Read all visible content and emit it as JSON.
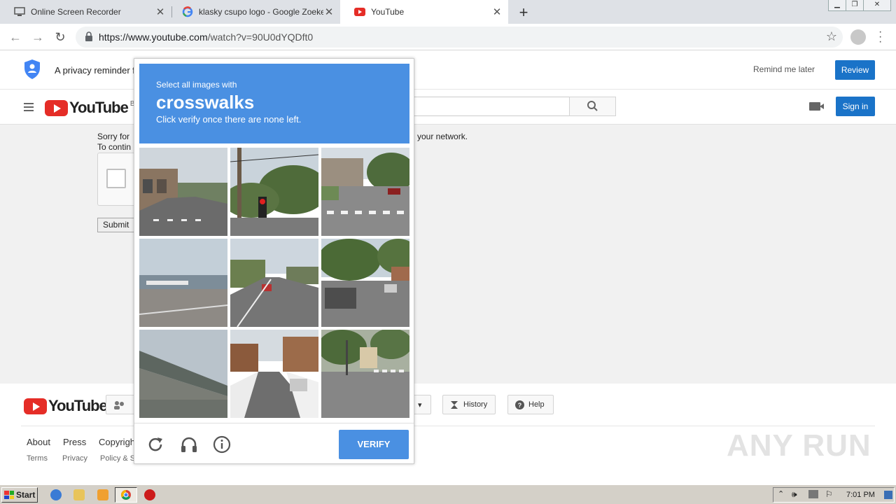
{
  "browser": {
    "tabs": [
      {
        "title": "Online Screen Recorder",
        "active": false
      },
      {
        "title": "klasky csupo logo - Google Zoeken",
        "active": false
      },
      {
        "title": "YouTube",
        "active": true
      }
    ],
    "url_host": "https://www.youtube.com",
    "url_path": "/watch?v=90U0dYQDft0"
  },
  "privacy": {
    "text": "A privacy reminder f",
    "remind_label": "Remind me later",
    "review_label": "Review"
  },
  "masthead": {
    "logo_text": "YouTube",
    "country_code": "BE",
    "signin_label": "Sign in"
  },
  "page": {
    "sorry_line1": "Sorry for",
    "sorry_line2": "To contin",
    "network_text": "n your network.",
    "submit_label": "Submit"
  },
  "footer": {
    "logo_text": "YouTube",
    "history_label": "History",
    "help_label": "Help",
    "links": [
      "About",
      "Press",
      "Copyrigh"
    ],
    "small_links": [
      "Terms",
      "Privacy",
      "Policy & S"
    ],
    "watermark": "ANY RUN"
  },
  "captcha": {
    "instruction": "Select all images with",
    "target": "crosswalks",
    "hint": "Click verify once there are none left.",
    "verify_label": "VERIFY",
    "tiles": [
      "street-shops",
      "traffic-light",
      "crosswalk-intersection",
      "harbor-road",
      "highway-car",
      "parked-cars-street",
      "overpass",
      "snowy-street",
      "crosswalk-corner"
    ]
  },
  "taskbar": {
    "start_label": "Start",
    "clock": "7:01 PM"
  },
  "colors": {
    "captcha_blue": "#4a90e2",
    "yt_red": "#e52d27",
    "button_blue": "#1a73c8"
  }
}
